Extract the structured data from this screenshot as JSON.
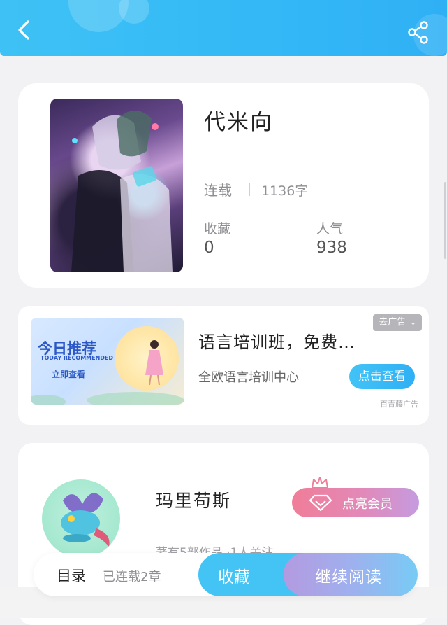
{
  "header": {
    "back_icon": "chevron-left-icon",
    "share_icon": "share-icon",
    "accent": "#34b8f6"
  },
  "book": {
    "title": "代米向",
    "status": "连载",
    "word_count": "1136字",
    "favorites_label": "收藏",
    "favorites_value": "0",
    "popularity_label": "人气",
    "popularity_value": "938"
  },
  "ad": {
    "image_title": "今日推荐",
    "image_subtitle": "TODAY RECOMMENDED",
    "image_button": "立即查看",
    "close_label": "去广告",
    "title": "语言培训班，免费…",
    "description": "全欧语言培训中心",
    "button": "点击查看",
    "source": "百青藤广告"
  },
  "author": {
    "name": "玛里苟斯",
    "vip_button": "点亮会员",
    "meta": "著有5部作品 ·1人关注"
  },
  "bottom_bar": {
    "toc_label": "目录",
    "chapters": "已连载2章",
    "favorite_button": "收藏",
    "read_button": "继续阅读"
  }
}
